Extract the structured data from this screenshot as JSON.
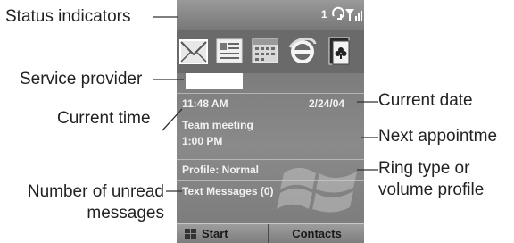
{
  "callouts": {
    "status_indicators": "Status indicators",
    "service_provider": "Service provider",
    "current_time": "Current time",
    "unread_line1": "Number of unread",
    "unread_line2": "messages",
    "current_date": "Current date",
    "next_appointment": "Next appointme",
    "ring_line1": "Ring type or",
    "ring_line2": "volume profile"
  },
  "phone": {
    "status_count": "1",
    "apps": [
      "envelope-icon",
      "contacts-card-icon",
      "calendar-icon",
      "internet-explorer-icon",
      "solitaire-icon"
    ],
    "time": "11:48 AM",
    "date": "2/24/04",
    "appointment_title": "Team meeting",
    "appointment_time": "1:00 PM",
    "profile": "Profile: Normal",
    "text_messages": "Text Messages (0)",
    "softkey_left": "Start",
    "softkey_right": "Contacts"
  },
  "colors": {
    "screen": "#7a7a7a",
    "leader_lines": "#333333",
    "callout_text": "#222222"
  }
}
